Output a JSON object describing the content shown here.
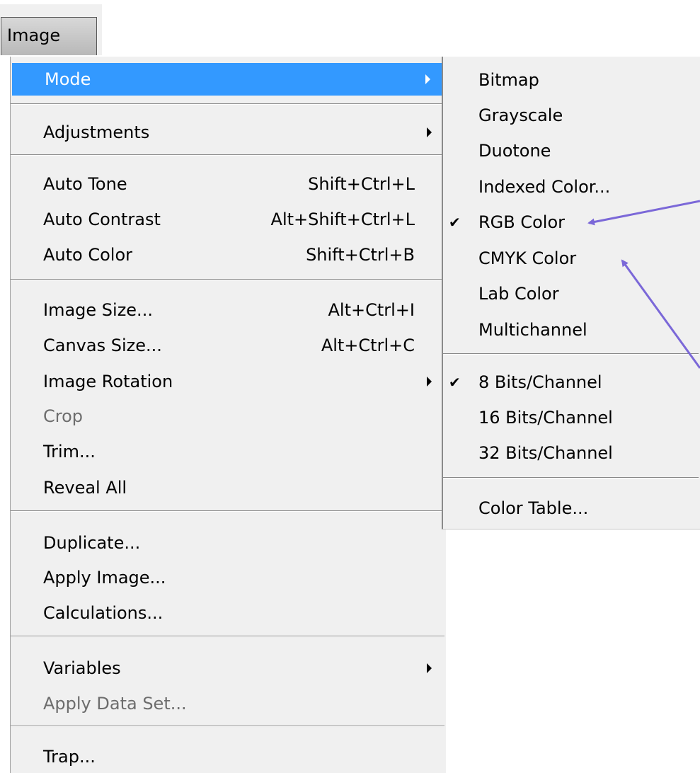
{
  "menubar": {
    "image_label": "Image"
  },
  "main_menu": {
    "mode": "Mode",
    "adjustments": "Adjustments",
    "auto_tone": {
      "label": "Auto Tone",
      "shortcut": "Shift+Ctrl+L"
    },
    "auto_contrast": {
      "label": "Auto Contrast",
      "shortcut": "Alt+Shift+Ctrl+L"
    },
    "auto_color": {
      "label": "Auto Color",
      "shortcut": "Shift+Ctrl+B"
    },
    "image_size": {
      "label": "Image Size...",
      "shortcut": "Alt+Ctrl+I"
    },
    "canvas_size": {
      "label": "Canvas Size...",
      "shortcut": "Alt+Ctrl+C"
    },
    "image_rotation": "Image Rotation",
    "crop": "Crop",
    "trim": "Trim...",
    "reveal_all": "Reveal All",
    "duplicate": "Duplicate...",
    "apply_image": "Apply Image...",
    "calculations": "Calculations...",
    "variables": "Variables",
    "apply_data_set": "Apply Data Set...",
    "trap": "Trap..."
  },
  "mode_submenu": {
    "bitmap": "Bitmap",
    "grayscale": "Grayscale",
    "duotone": "Duotone",
    "indexed_color": "Indexed Color...",
    "rgb_color": "RGB Color",
    "cmyk_color": "CMYK Color",
    "lab_color": "Lab Color",
    "multichannel": "Multichannel",
    "bits_8": "8 Bits/Channel",
    "bits_16": "16 Bits/Channel",
    "bits_32": "32 Bits/Channel",
    "color_table": "Color Table...",
    "checkmark": "✔"
  },
  "colors": {
    "highlight": "#3399ff",
    "menu_bg": "#f0f0f0",
    "annotation_arrow": "#7b68d8"
  }
}
